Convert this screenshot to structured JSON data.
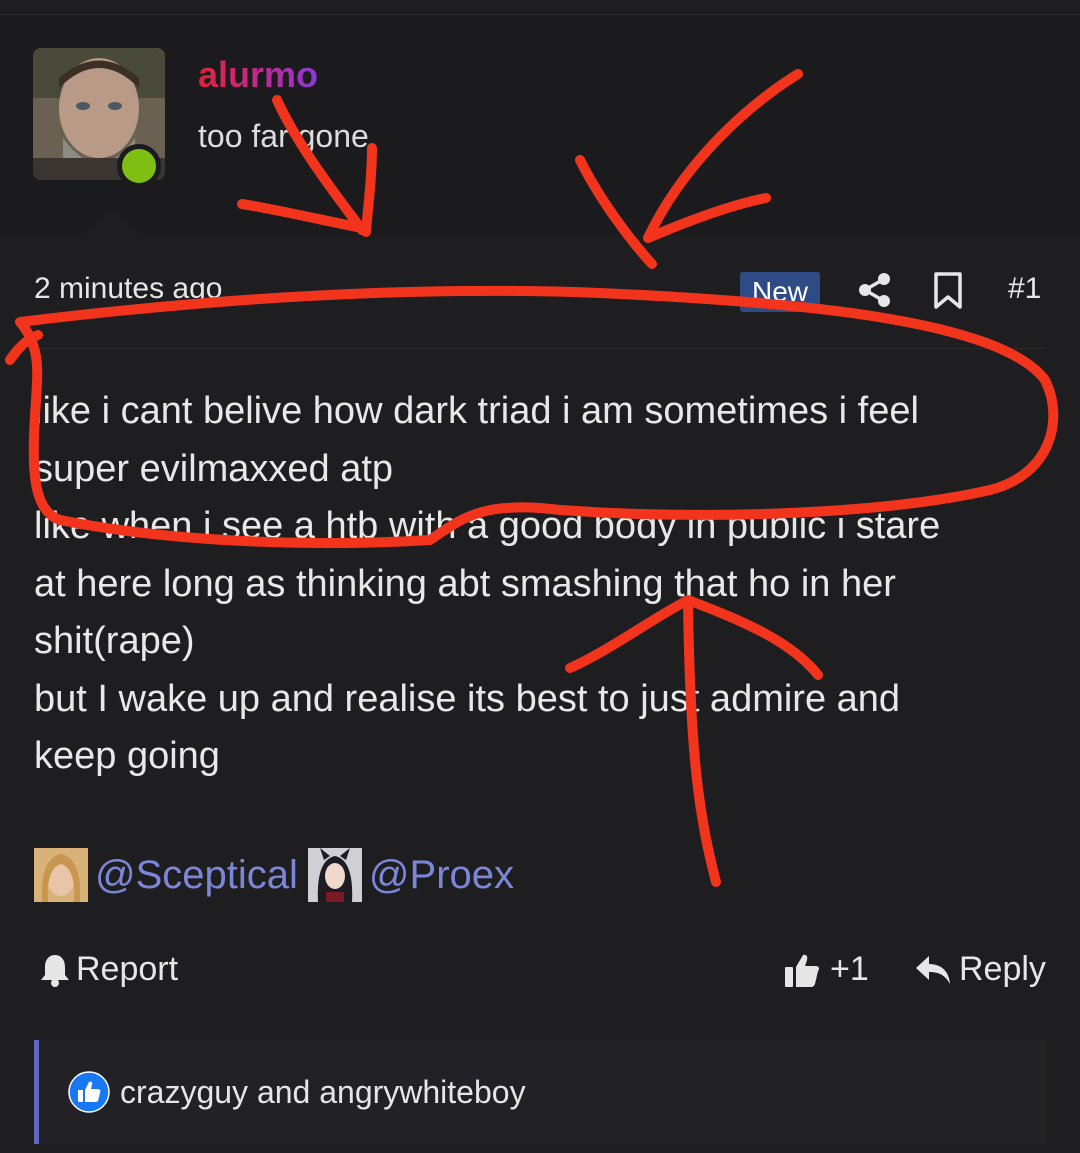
{
  "user": {
    "name": "alurmo",
    "title": "too far gone",
    "online": true
  },
  "post": {
    "timestamp": "2 minutes ago",
    "badge": "New",
    "number": "#1",
    "lines": [
      "like i cant belive how dark triad i am sometimes i feel",
      "super evilmaxxed atp",
      "like when i see a htb with a good body in public i stare",
      "at here long as thinking abt smashing that ho in her",
      "shit(rape)",
      "but I wake up and realise its best to just admire and",
      "keep going"
    ],
    "mentions": [
      "@Sceptical",
      "@Proex"
    ]
  },
  "actions": {
    "report": "Report",
    "like_count": "+1",
    "reply": "Reply"
  },
  "reactions": {
    "text": "crazyguy and angrywhiteboy"
  },
  "icons": {
    "share": "share-icon",
    "bookmark": "bookmark-icon",
    "bell": "bell-icon",
    "thumbs_up": "thumbs-up-icon",
    "reply": "reply-arrow-icon",
    "like_reaction": "like-reaction-icon"
  },
  "colors": {
    "background": "#1e1e20",
    "badge": "#2f4b86",
    "mention": "#7c86d6",
    "online": "#7fbf14",
    "annotation": "#f2341d",
    "reaction_border": "#5c6bc0"
  }
}
